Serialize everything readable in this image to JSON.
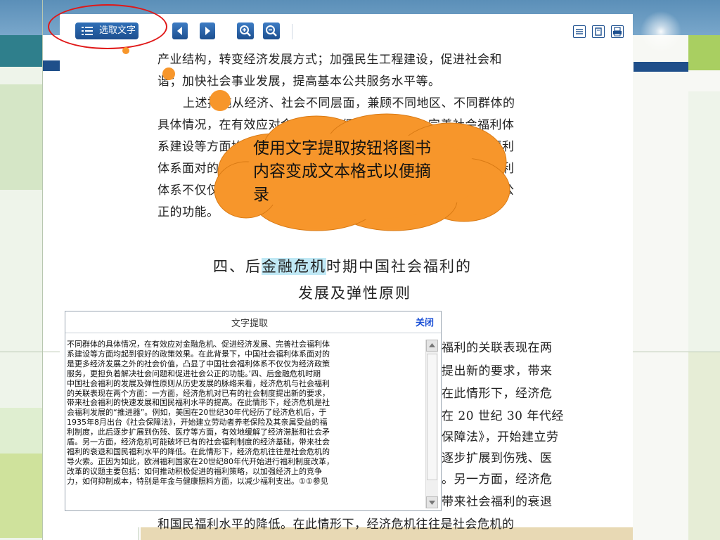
{
  "toolbar": {
    "extract_label": "选取文字"
  },
  "page": {
    "lines": [
      "产业结构，转变经济发展方式；加强民生工程建设，促进社会和",
      "谐；加快社会事业发展，提高基本公共服务水平等。",
      "上述措施从经济、社会不同层面，兼顾不同地区、不同群体的",
      "具体情况，在有效应对金融危机、促进经济发展、完善社会福利体",
      "系建设等方面均起到很好的政策效果。在此背景下，中国社会福利",
      "体系面对的是更多经济发展之外的社会价值，凸显了中国社会福利",
      "体系不仅仅为经济政策服务，更担负着解决社会问题和促进社会公",
      "正的功能。"
    ],
    "heading_line1_pre": "四、后",
    "heading_line1_hl": "金融危机",
    "heading_line1_post": "时期中国社会福利的",
    "heading_line2": "发展及弹性原则",
    "right_lines": [
      "福利的关联表现在两",
      "提出新的要求，带来",
      "在此情形下，经济危",
      "在 20 世纪 30 年代经",
      "保障法》，开始建立劳",
      "逐步扩展到伤残、医",
      "。另一方面，经济危",
      "带来社会福利的衰退"
    ],
    "bottom_line": "和国民福利水平的降低。在此情形下，经济危机往往是社会危机的"
  },
  "callout": {
    "text": "使用文字提取按钮将图书内容变成文本格式以便摘录"
  },
  "panel": {
    "title": "文字提取",
    "close_label": "关闭",
    "lines": [
      "不同群体的具体情况，在有效应对金融危机、促进经济发展、完善社会福利体",
      "系建设等方面均起到很好的政策效果。在此背景下，中国社会福利体系面对的",
      "是更多经济发展之外的社会价值，凸显了中国社会福利体系不仅仅为经济政策",
      "服务，更担负着解决社会问题和促进社会公正的功能。’四、后金融危机时期",
      "中国社会福利的发展及弹性原则从历史发展的脉络来看，经济危机与社会福利",
      "的关联表现在两个方面：一方面，经济危机对已有的社会制度提出新的要求，",
      "带来社会福利的快速发展和国民福利水平的提高。在此情形下，经济危机是社",
      "会福利发展的“推进器”。例如，美国在20世纪30年代经历了经济危机后，于",
      "1935年8月出台《社会保障法》，开始建立劳动者养老保险及其亲属受益的福",
      "利制度，此后逐步扩展到伤残、医疗等方面，有效地缓解了经济滞胀和社会矛",
      "盾。另一方面，经济危机可能破坏已有的社会福利制度的经济基础，带来社会",
      "福利的衰退和国民福利水平的降低。在此情形下，经济危机往往是社会危机的",
      "导火索。正因为如此，欧洲福利国家在20世纪80年代开始进行福利制度改革，",
      "改革的议题主要包括：如何推动积极促进的福利策略，以加强经济上的竞争",
      "力，如何抑制成本，特别是年金与健康照料方面，以减少福利支出。①①参见"
    ]
  },
  "colors": {
    "accent_orange": "#f7962b",
    "toolbar_blue": "#1d4f8f",
    "highlight_oval": "#e01818",
    "link_blue": "#1a4fd6"
  }
}
